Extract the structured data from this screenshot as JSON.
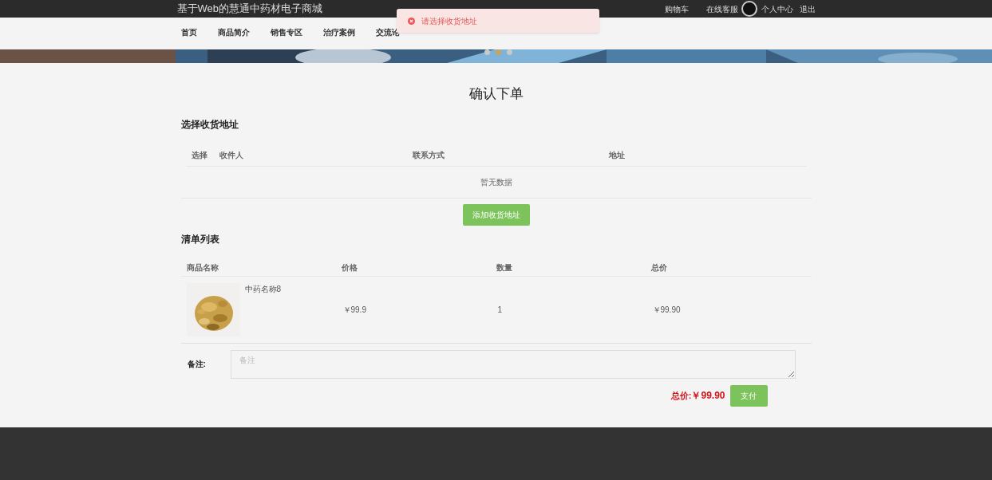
{
  "site_title": "基于Web的慧通中药材电子商城",
  "top_links": [
    {
      "kind": "link",
      "label": "购物车"
    },
    {
      "kind": "link",
      "label": "在线客服"
    },
    {
      "kind": "avatar",
      "label": "个人中心"
    },
    {
      "kind": "link",
      "label": "退出"
    }
  ],
  "nav": [
    {
      "label": "首页"
    },
    {
      "label": "商品简介"
    },
    {
      "label": "销售专区"
    },
    {
      "label": "治疗案例"
    },
    {
      "label": "交流论"
    }
  ],
  "toast": {
    "kind": "error",
    "message": "请选择收货地址"
  },
  "carousel_dots": [
    {
      "selected": false
    },
    {
      "selected": true
    },
    {
      "selected": false
    }
  ],
  "page_title": "确认下单",
  "address_section": {
    "title": "选择收货地址",
    "columns": [
      "选择",
      "收件人",
      "联系方式",
      "地址"
    ],
    "empty_text": "暂无数据",
    "add_button": "添加收货地址"
  },
  "order_section": {
    "title": "清单列表",
    "columns": [
      "商品名称",
      "价格",
      "数量",
      "总价"
    ],
    "rows": [
      {
        "name": "中药名称8",
        "price": "￥99.9",
        "quantity": "1",
        "total": "￥99.90"
      }
    ]
  },
  "remark": {
    "label": "备注:",
    "placeholder": "备注"
  },
  "total": {
    "label": "总价:",
    "value": "￥99.90"
  },
  "pay_button": "支付"
}
